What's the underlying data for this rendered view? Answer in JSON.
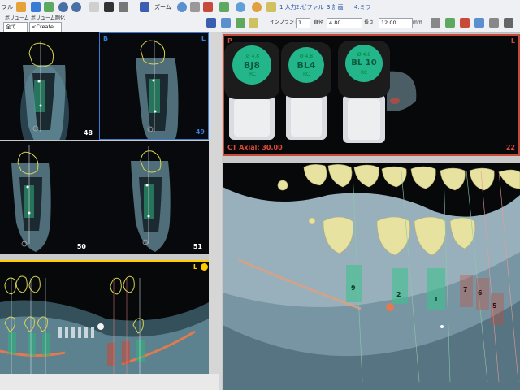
{
  "toolbar": {
    "row1": {
      "fragment1": "フル",
      "zoom_label": "ズーム",
      "tab1": "1.入力",
      "tab2": "2.ゼファル",
      "tab3": "3.計画",
      "tab4": "4.ミラ"
    },
    "row2": {
      "volume_label": "ボリューム",
      "volume_value": "全て",
      "volume_combo_label": "ボリューム剛化",
      "volume_combo_value": "<Create",
      "implant_label": "インプラント",
      "implant_value": "1",
      "diameter_label": "直径",
      "diameter_value": "4.80",
      "length_label": "長さ",
      "length_value": "12.00",
      "unit": "mm"
    }
  },
  "panels": {
    "top_left_a": {
      "letter": "",
      "slice": "48"
    },
    "top_left_b": {
      "letter": "B",
      "slice": "49",
      "corner": "L"
    },
    "mid_left_a": {
      "slice": "50"
    },
    "mid_left_b": {
      "slice": "51"
    },
    "axial": {
      "letter": "P",
      "corner": "L",
      "caption": "CT Axial: 30.00",
      "right_number": "22"
    },
    "panoramic": {
      "corner": "L"
    },
    "three_d": {
      "implant_numbers": [
        "9",
        "2",
        "1",
        "7",
        "6",
        "5"
      ]
    }
  },
  "vials": [
    {
      "line1": "Ø 4.8",
      "line2": "BJ8",
      "line3": "RC"
    },
    {
      "line1": "Ø 4.8",
      "line2": "BL4",
      "line3": "RC"
    },
    {
      "line1": "Ø 4.8",
      "line2": "BL 10",
      "line3": "RC"
    }
  ],
  "colors": {
    "accent_blue": "#3a7bd5",
    "panel_orange": "#ffcc00",
    "bone_blue": "#9ec4d8",
    "vial_green": "#23b68a",
    "implant_green": "#36c48a"
  }
}
